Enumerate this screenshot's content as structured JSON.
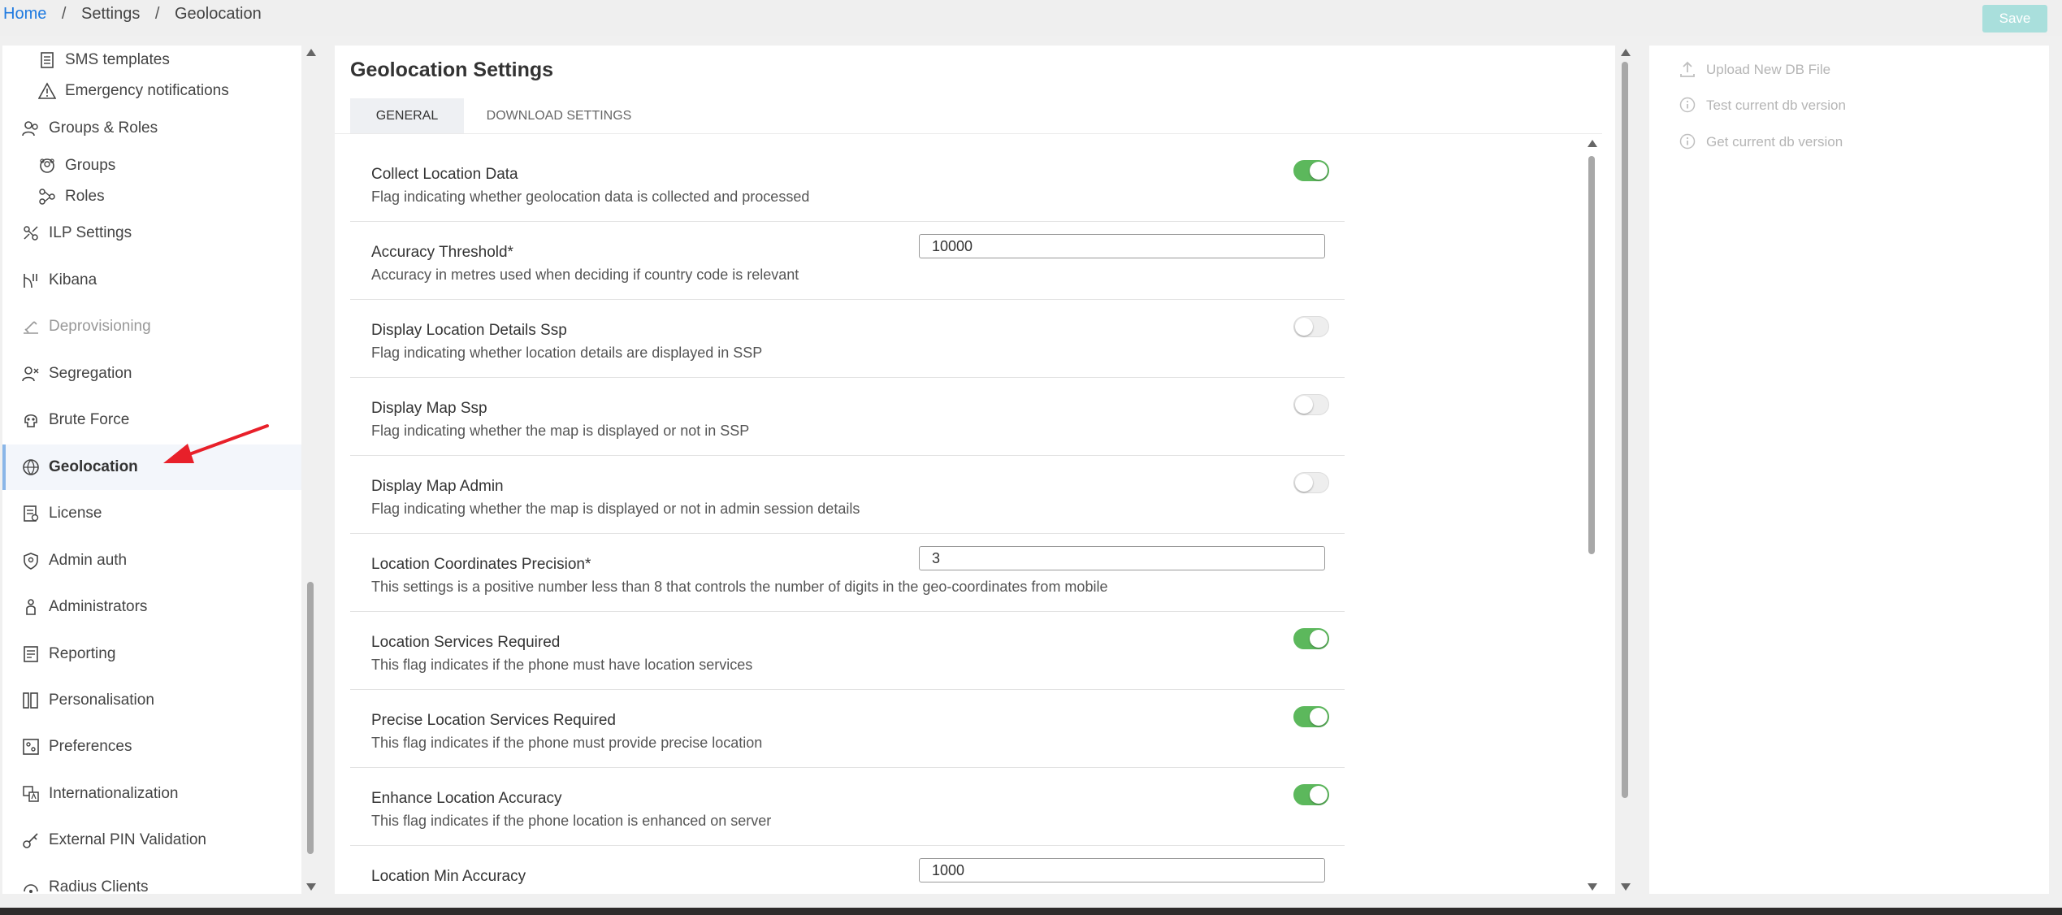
{
  "breadcrumb": {
    "home": "Home",
    "settings": "Settings",
    "current": "Geolocation",
    "separator": "/"
  },
  "header": {
    "save_label": "Save"
  },
  "sidebar": {
    "items": [
      {
        "label": "SMS templates",
        "icon": "document-icon",
        "sub": true
      },
      {
        "label": "Emergency notifications",
        "icon": "warning-icon",
        "sub": true
      },
      {
        "label": "Groups & Roles",
        "icon": "users-icon",
        "sub": false
      },
      {
        "label": "Groups",
        "icon": "group-icon",
        "sub": true
      },
      {
        "label": "Roles",
        "icon": "roles-icon",
        "sub": true
      },
      {
        "label": "ILP Settings",
        "icon": "ilp-icon",
        "sub": false
      },
      {
        "label": "Kibana",
        "icon": "kibana-icon",
        "sub": false
      },
      {
        "label": "Deprovisioning",
        "icon": "deprovisioning-icon",
        "sub": false
      },
      {
        "label": "Segregation",
        "icon": "segregation-icon",
        "sub": false
      },
      {
        "label": "Brute Force",
        "icon": "skull-icon",
        "sub": false
      },
      {
        "label": "Geolocation",
        "icon": "globe-icon",
        "sub": false,
        "active": true
      },
      {
        "label": "License",
        "icon": "license-icon",
        "sub": false
      },
      {
        "label": "Admin auth",
        "icon": "shield-icon",
        "sub": false
      },
      {
        "label": "Administrators",
        "icon": "person-icon",
        "sub": false
      },
      {
        "label": "Reporting",
        "icon": "report-icon",
        "sub": false
      },
      {
        "label": "Personalisation",
        "icon": "personalisation-icon",
        "sub": false
      },
      {
        "label": "Preferences",
        "icon": "preferences-icon",
        "sub": false
      },
      {
        "label": "Internationalization",
        "icon": "translate-icon",
        "sub": false
      },
      {
        "label": "External PIN Validation",
        "icon": "key-icon",
        "sub": false
      },
      {
        "label": "Radius Clients",
        "icon": "radius-icon",
        "sub": false
      }
    ]
  },
  "main": {
    "title": "Geolocation Settings",
    "tabs": [
      {
        "label": "GENERAL",
        "active": true
      },
      {
        "label": "DOWNLOAD SETTINGS",
        "active": false
      }
    ],
    "settings": [
      {
        "label": "Collect Location Data",
        "description": "Flag indicating whether geolocation data is collected and processed",
        "type": "toggle",
        "value": true
      },
      {
        "label": "Accuracy Threshold*",
        "description": "Accuracy in metres used when deciding if country code is relevant",
        "type": "input",
        "value": "10000"
      },
      {
        "label": "Display Location Details Ssp",
        "description": "Flag indicating whether location details are displayed in SSP",
        "type": "toggle",
        "value": false
      },
      {
        "label": "Display Map Ssp",
        "description": "Flag indicating whether the map is displayed or not in SSP",
        "type": "toggle",
        "value": false
      },
      {
        "label": "Display Map Admin",
        "description": "Flag indicating whether the map is displayed or not in admin session details",
        "type": "toggle",
        "value": false
      },
      {
        "label": "Location Coordinates Precision*",
        "description": "This settings is a positive number less than 8 that controls the number of digits in the geo-coordinates from mobile",
        "type": "input",
        "value": "3"
      },
      {
        "label": "Location Services Required",
        "description": "This flag indicates if the phone must have location services",
        "type": "toggle",
        "value": true
      },
      {
        "label": "Precise Location Services Required",
        "description": "This flag indicates if the phone must provide precise location",
        "type": "toggle",
        "value": true
      },
      {
        "label": "Enhance Location Accuracy",
        "description": "This flag indicates if the phone location is enhanced on server",
        "type": "toggle",
        "value": true
      },
      {
        "label": "Location Min Accuracy",
        "description": "",
        "type": "input",
        "value": "1000"
      }
    ]
  },
  "right_panel": {
    "actions": [
      {
        "label": "Upload New DB File",
        "icon": "upload-icon"
      },
      {
        "label": "Test current db version",
        "icon": "info-icon"
      },
      {
        "label": "Get current db version",
        "icon": "info-icon"
      }
    ]
  },
  "colors": {
    "link": "#1f7ae0",
    "toggle_on": "#5cb85c",
    "save_button": "#a9dfdc",
    "annotation_arrow": "#e8202a"
  }
}
